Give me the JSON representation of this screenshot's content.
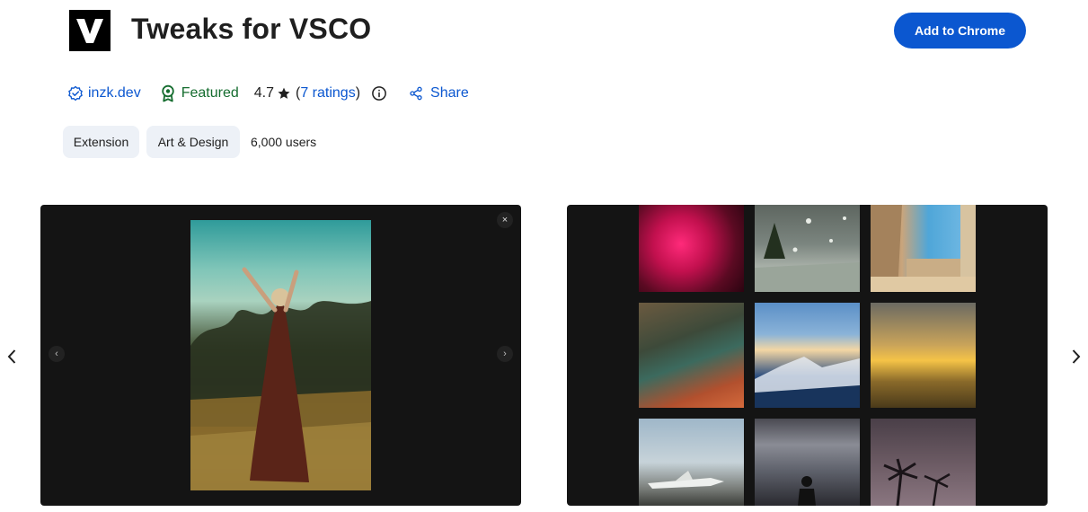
{
  "header": {
    "logo_letter": "V",
    "title": "Tweaks for VSCO",
    "add_button_label": "Add to Chrome"
  },
  "meta": {
    "developer": "inzk.dev",
    "featured_label": "Featured",
    "rating_value": "4.7",
    "ratings_open": "(",
    "ratings_count_label": "7 ratings",
    "ratings_close": ")",
    "share_label": "Share"
  },
  "tags": {
    "type_label": "Extension",
    "category_label": "Art & Design",
    "users_label": "6,000 users"
  },
  "screenshots": {
    "close_glyph": "×",
    "prev_glyph": "‹",
    "next_glyph": "›"
  },
  "colors": {
    "primary": "#0b57d0",
    "featured_green": "#146c2e",
    "chip_bg": "#edf1f7",
    "slide_bg": "#141414"
  },
  "icons": [
    "verified-badge-icon",
    "featured-award-icon",
    "star-icon",
    "info-icon",
    "share-icon",
    "chevron-left-icon",
    "chevron-right-icon",
    "close-icon"
  ]
}
